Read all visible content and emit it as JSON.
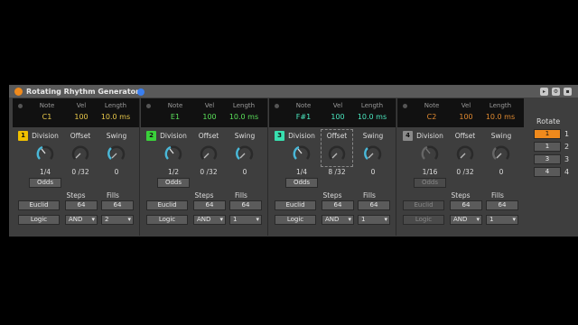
{
  "device": {
    "title": "Rotating Rhythm Generator",
    "colors": {
      "power": "#f08a1c",
      "pin": "#3a7ff0"
    }
  },
  "panels": [
    {
      "index": "1",
      "color": "#f0c000",
      "note": "C1",
      "vel": "100",
      "length": "10.0 ms",
      "value_color": "#e8c84a",
      "division": "1/4",
      "offset": "0 /32",
      "swing": "0",
      "steps": "64",
      "fills": "64",
      "logic": "AND",
      "fills_sel": "2",
      "disabled": false
    },
    {
      "index": "2",
      "color": "#3ad23a",
      "note": "E1",
      "vel": "100",
      "length": "10.0 ms",
      "value_color": "#5ae05a",
      "division": "1/2",
      "offset": "0 /32",
      "swing": "0",
      "steps": "64",
      "fills": "64",
      "logic": "AND",
      "fills_sel": "1",
      "disabled": false
    },
    {
      "index": "3",
      "color": "#38e0b0",
      "note": "F#1",
      "vel": "100",
      "length": "10.0 ms",
      "value_color": "#4ae8c0",
      "division": "1/4",
      "offset": "8 /32",
      "swing": "0",
      "steps": "64",
      "fills": "64",
      "logic": "AND",
      "fills_sel": "1",
      "disabled": false
    },
    {
      "index": "4",
      "color": "#8a8a8a",
      "note": "C2",
      "vel": "100",
      "length": "10.0 ms",
      "value_color": "#e08a30",
      "division": "1/16",
      "offset": "0 /32",
      "swing": "0",
      "steps": "64",
      "fills": "64",
      "logic": "AND",
      "fills_sel": "1",
      "disabled": true
    }
  ],
  "labels": {
    "note": "Note",
    "vel": "Vel",
    "length": "Length",
    "division": "Division",
    "offset": "Offset",
    "swing": "Swing",
    "odds": "Odds",
    "steps": "Steps",
    "fills": "Fills",
    "euclid": "Euclid",
    "logic": "Logic"
  },
  "rotate": {
    "title": "Rotate",
    "buttons": [
      "1",
      "1",
      "3",
      "4"
    ],
    "numbers": [
      "1",
      "2",
      "3",
      "4"
    ],
    "active_color": "#f08a1c"
  }
}
